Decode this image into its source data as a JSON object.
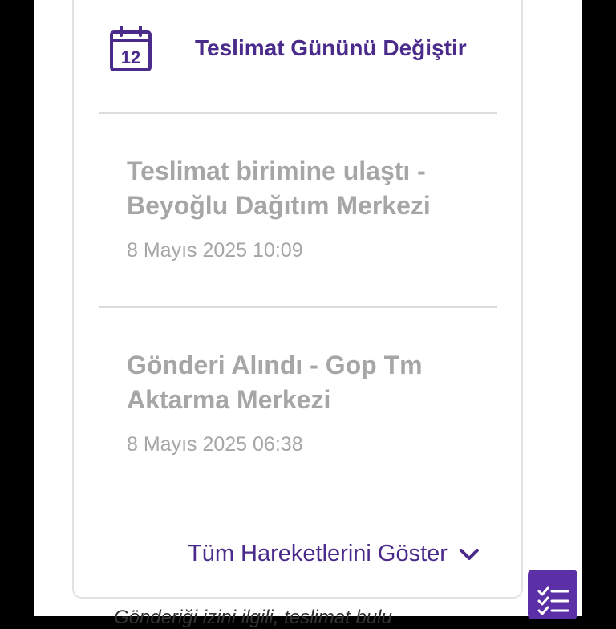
{
  "actions": {
    "change_delivery_day_label": "Teslimat Gününü Değiştir",
    "calendar_day": "12",
    "show_all_label": "Tüm Hareketlerini Göster"
  },
  "events": [
    {
      "title": "Teslimat birimine ulaştı - Beyoğlu Dağıtım Merkezi",
      "time": "8 Mayıs 2025 10:09"
    },
    {
      "title": "Gönderi Alındı - Gop Tm Aktarma Merkezi",
      "time": "8 Mayıs 2025 06:38"
    }
  ],
  "footer": {
    "partial_text": "Gönderiği izini ilgili, teslimat bulu"
  },
  "icons": {
    "calendar": "calendar-icon",
    "chevron": "chevron-down-icon",
    "checklist": "checklist-icon"
  },
  "colors": {
    "accent": "#4a2a8a",
    "fab": "#5b2fa6",
    "muted_text": "#a6a6a6",
    "divider": "#dcdcdc"
  }
}
